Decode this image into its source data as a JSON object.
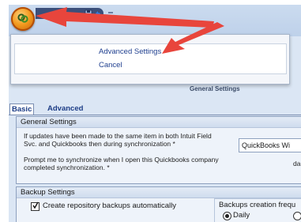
{
  "app_menu": {
    "items": [
      {
        "label": "Advanced Settings"
      },
      {
        "label": "Cancel"
      }
    ]
  },
  "form": {
    "title": "General Settings"
  },
  "tabs": [
    {
      "label": "Basic",
      "active": true
    },
    {
      "label": "Advanced",
      "active": false
    }
  ],
  "general_settings": {
    "header": "General Settings",
    "update_conflict_text_1": "If updates have been made to the same item in both Intuit Field",
    "update_conflict_text_2": "Svc. and Quickbooks then during synchronization *",
    "update_conflict_value": "QuickBooks Wi",
    "prompt_text_1": "Prompt me to synchronize when I open this Quickbooks company",
    "prompt_text_2": "completed synchronization. *",
    "prompt_value": "da"
  },
  "backup_settings": {
    "header": "Backup Settings",
    "create_backups_label": "Create repository backups automatically",
    "create_backups_checked": true,
    "frequency_label": "Backups creation frequ",
    "frequency_options": [
      {
        "label": "Daily",
        "selected": true
      },
      {
        "label": "",
        "selected": false
      }
    ]
  },
  "annotation_color": "#e8453c",
  "icons": [
    "app-orb-icon",
    "save-icon",
    "undo-icon",
    "check-icon"
  ]
}
